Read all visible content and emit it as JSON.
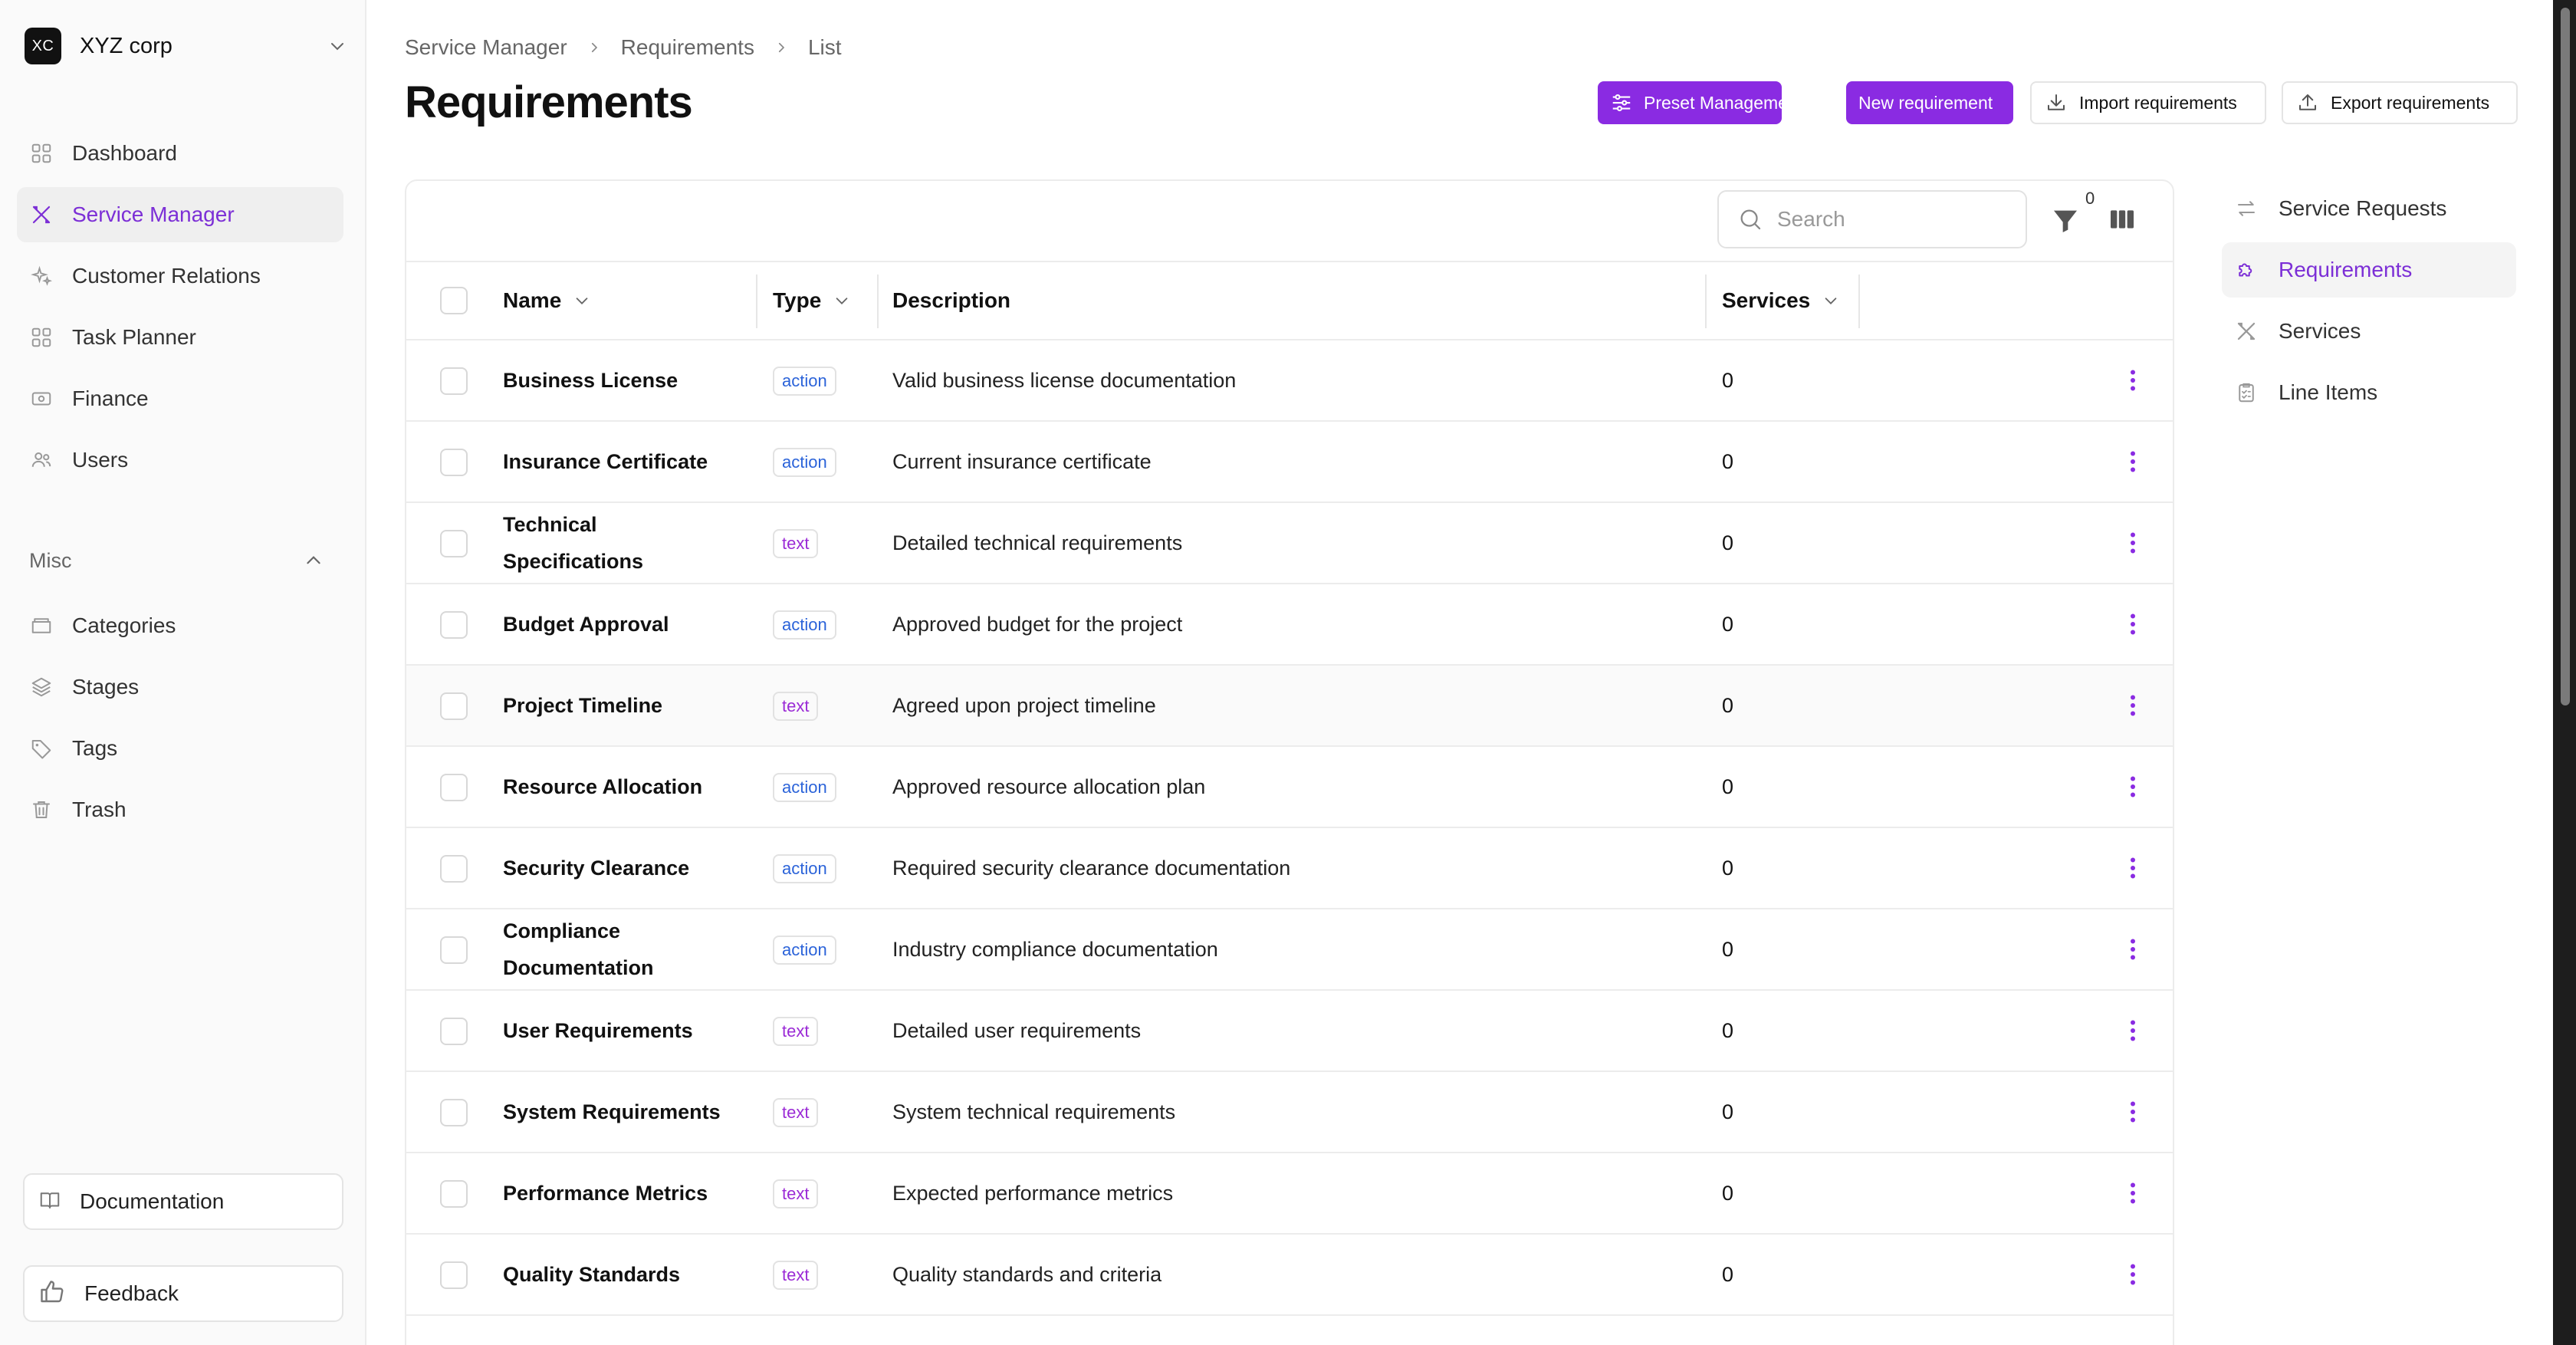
{
  "org": {
    "logo": "XC",
    "name": "XYZ corp"
  },
  "sidebar": {
    "items": [
      {
        "label": "Dashboard",
        "icon": "grid-icon"
      },
      {
        "label": "Service Manager",
        "icon": "tools-icon",
        "active": true
      },
      {
        "label": "Customer Relations",
        "icon": "sparkle-icon"
      },
      {
        "label": "Task Planner",
        "icon": "grid-icon"
      },
      {
        "label": "Finance",
        "icon": "money-icon"
      },
      {
        "label": "Users",
        "icon": "users-icon"
      }
    ],
    "misc_label": "Misc",
    "misc_items": [
      {
        "label": "Categories",
        "icon": "folder-icon"
      },
      {
        "label": "Stages",
        "icon": "layers-icon"
      },
      {
        "label": "Tags",
        "icon": "tag-icon"
      },
      {
        "label": "Trash",
        "icon": "trash-icon"
      }
    ],
    "documentation_label": "Documentation",
    "feedback_label": "Feedback"
  },
  "breadcrumb": [
    "Service Manager",
    "Requirements",
    "List"
  ],
  "page_title": "Requirements",
  "toolbar": {
    "preset_label": "Preset Management",
    "new_label": "New requirement",
    "import_label": "Import requirements",
    "export_label": "Export requirements"
  },
  "search": {
    "placeholder": "Search"
  },
  "filter_count": "0",
  "table": {
    "headers": {
      "name": "Name",
      "type": "Type",
      "description": "Description",
      "services": "Services"
    },
    "rows": [
      {
        "name": "Business License",
        "type": "action",
        "description": "Valid business license documentation",
        "services": "0"
      },
      {
        "name": "Insurance Certificate",
        "type": "action",
        "description": "Current insurance certificate",
        "services": "0"
      },
      {
        "name": "Technical Specifications",
        "type": "text",
        "description": "Detailed technical requirements",
        "services": "0"
      },
      {
        "name": "Budget Approval",
        "type": "action",
        "description": "Approved budget for the project",
        "services": "0"
      },
      {
        "name": "Project Timeline",
        "type": "text",
        "description": "Agreed upon project timeline",
        "services": "0"
      },
      {
        "name": "Resource Allocation",
        "type": "action",
        "description": "Approved resource allocation plan",
        "services": "0"
      },
      {
        "name": "Security Clearance",
        "type": "action",
        "description": "Required security clearance documentation",
        "services": "0"
      },
      {
        "name": "Compliance Documentation",
        "type": "action",
        "description": "Industry compliance documentation",
        "services": "0"
      },
      {
        "name": "User Requirements",
        "type": "text",
        "description": "Detailed user requirements",
        "services": "0"
      },
      {
        "name": "System Requirements",
        "type": "text",
        "description": "System technical requirements",
        "services": "0"
      },
      {
        "name": "Performance Metrics",
        "type": "text",
        "description": "Expected performance metrics",
        "services": "0"
      },
      {
        "name": "Quality Standards",
        "type": "text",
        "description": "Quality standards and criteria",
        "services": "0"
      }
    ]
  },
  "right_nav": [
    {
      "label": "Service Requests",
      "icon": "swap-icon"
    },
    {
      "label": "Requirements",
      "icon": "puzzle-icon",
      "active": true
    },
    {
      "label": "Services",
      "icon": "tools-icon"
    },
    {
      "label": "Line Items",
      "icon": "checklist-icon"
    }
  ],
  "colors": {
    "accent": "#8a2be2",
    "active_text": "#7c2fd6",
    "badge_action": "#2b63d9",
    "badge_text": "#9b2bd6"
  }
}
